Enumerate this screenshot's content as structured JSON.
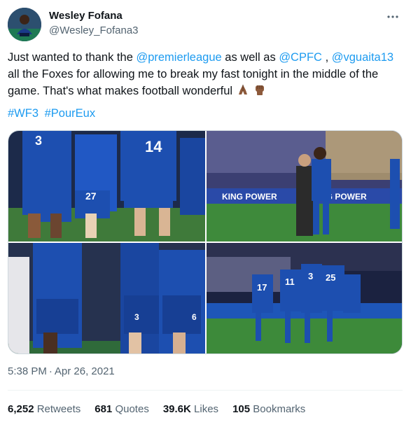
{
  "author": {
    "name": "Wesley Fofana",
    "handle": "@Wesley_Fofana3"
  },
  "tweet": {
    "text_parts": [
      "Just wanted to thank the ",
      "@premierleague",
      " as well as ",
      "@CPFC",
      " , ",
      "@vguaita13",
      " all the Foxes for allowing me to break my fast tonight in the middle of the game. That's what makes football wonderful "
    ],
    "hashtags": [
      "#WF3",
      "#PourEux"
    ],
    "emojis": [
      "folded-hands-icon",
      "raised-fist-icon"
    ],
    "timestamp_time": "5:38 PM",
    "timestamp_date": "Apr 26, 2021"
  },
  "stats": {
    "retweets_count": "6,252",
    "retweets_label": "Retweets",
    "quotes_count": "681",
    "quotes_label": "Quotes",
    "likes_count": "39.6K",
    "likes_label": "Likes",
    "bookmarks_count": "105",
    "bookmarks_label": "Bookmarks"
  },
  "photo_text": {
    "jersey_14": "14",
    "jersey_27": "27",
    "jersey_3": "3",
    "board_1": "KING POWER",
    "board_2": "KING POWER",
    "jersey_17": "17",
    "jersey_11": "11",
    "jersey_3b": "3",
    "jersey_25": "25",
    "jersey_6": "6"
  },
  "colors": {
    "link": "#1d9bf0",
    "secondary_text": "#536471",
    "leicester_blue": "#1d4fb0"
  }
}
